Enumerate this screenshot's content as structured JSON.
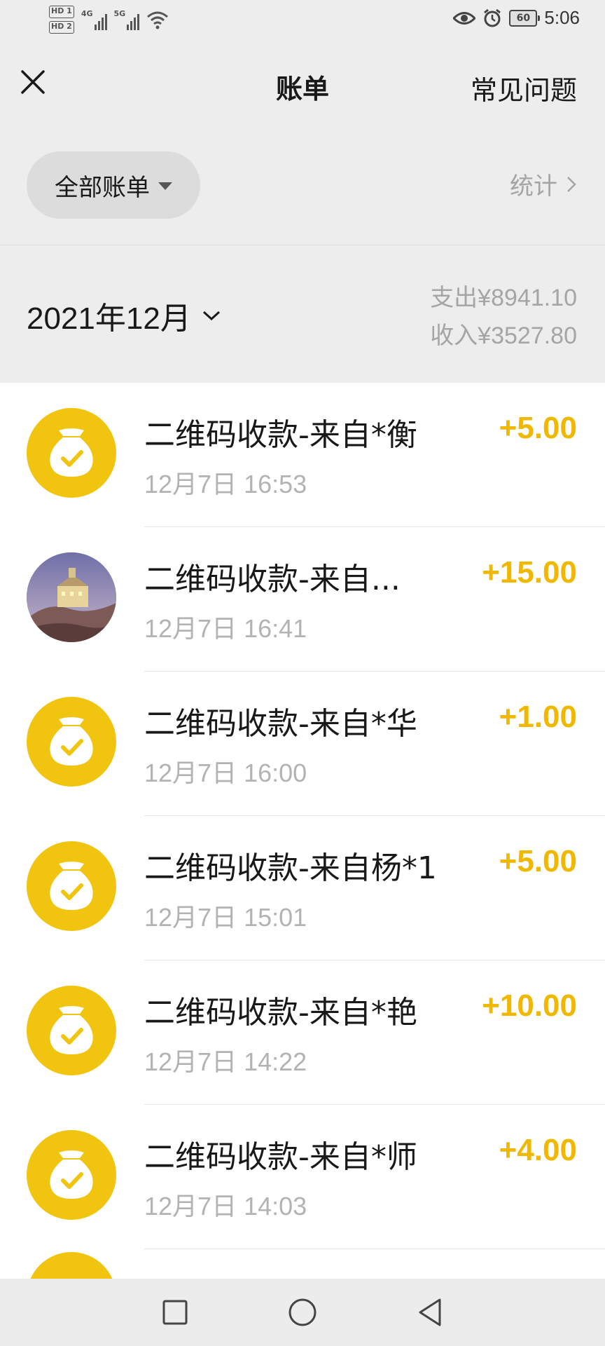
{
  "status_bar": {
    "sim1": "HD 1",
    "sim2": "HD 2",
    "net1": "4G",
    "net2": "5G",
    "battery": "60",
    "time": "5:06"
  },
  "nav": {
    "title": "账单",
    "faq": "常见问题",
    "close_icon": "close-icon"
  },
  "filter": {
    "all_bills": "全部账单",
    "stats": "统计"
  },
  "month": {
    "label": "2021年12月",
    "expense": "支出¥8941.10",
    "income": "收入¥3527.80"
  },
  "transactions": [
    {
      "title": "二维码收款-来自*衡",
      "time": "12月7日 16:53",
      "amount": "+5.00",
      "icon": "money-bag-icon"
    },
    {
      "title": "二维码收款-来自...",
      "time": "12月7日 16:41",
      "amount": "+15.00",
      "icon": "user-photo-avatar"
    },
    {
      "title": "二维码收款-来自*华",
      "time": "12月7日 16:00",
      "amount": "+1.00",
      "icon": "money-bag-icon"
    },
    {
      "title": "二维码收款-来自杨*1",
      "time": "12月7日 15:01",
      "amount": "+5.00",
      "icon": "money-bag-icon"
    },
    {
      "title": "二维码收款-来自*艳",
      "time": "12月7日 14:22",
      "amount": "+10.00",
      "icon": "money-bag-icon"
    },
    {
      "title": "二维码收款-来自*师",
      "time": "12月7日 14:03",
      "amount": "+4.00",
      "icon": "money-bag-icon"
    }
  ],
  "colors": {
    "accent_yellow": "#f0b800",
    "icon_yellow": "#f1c40f",
    "background": "#ededed"
  }
}
